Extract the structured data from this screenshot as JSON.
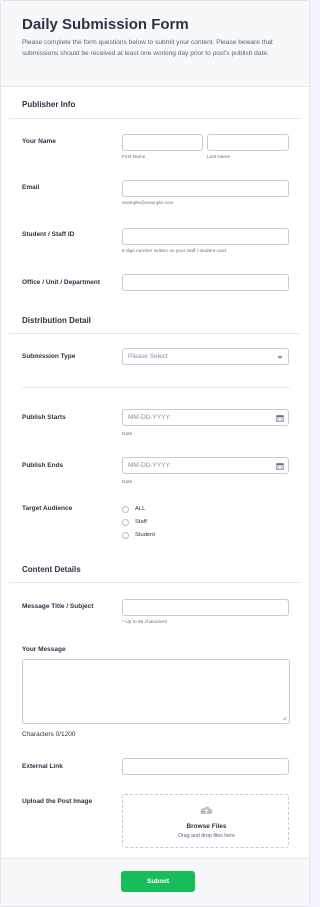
{
  "header": {
    "title": "Daily Submission Form",
    "description": "Please complete the form questions below to submit your content. Please beware that submissions should be received at least one working day prior to post's publish date."
  },
  "publisher": {
    "section_title": "Publisher Info",
    "name_label": "Your Name",
    "first_name_sublabel": "First Name",
    "last_name_sublabel": "Last Name",
    "email_label": "Email",
    "email_sublabel": "example@example.com",
    "id_label": "Student / Staff ID",
    "id_sublabel": "8 digit number written on your staff / student card.",
    "office_label": "Office / Unit / Department"
  },
  "distribution": {
    "section_title": "Distribution Detail",
    "type_label": "Submission Type",
    "type_placeholder": "Please Select",
    "starts_label": "Publish Starts",
    "starts_placeholder": "MM-DD-YYYY",
    "starts_sublabel": "Date",
    "ends_label": "Publish Ends",
    "ends_placeholder": "MM-DD-YYYY",
    "ends_sublabel": "Date",
    "audience_label": "Target Audience",
    "audience_options": [
      "ALL",
      "Staff",
      "Student"
    ]
  },
  "content": {
    "section_title": "Content Details",
    "title_label": "Message Title / Subject",
    "title_sublabel": "* Up to 65 characters",
    "message_label": "Your Message",
    "char_count": "Characters 0/1200",
    "link_label": "External Link",
    "upload_label": "Upload the Post Image",
    "browse_label": "Browse Files",
    "drag_text": "Drag and drop files here"
  },
  "footer": {
    "submit_label": "Submit"
  },
  "colors": {
    "accent": "#18bd5b",
    "border": "#c3cad8",
    "text": "#2c3345"
  }
}
